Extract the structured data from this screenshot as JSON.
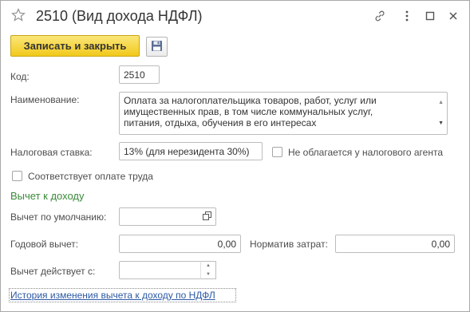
{
  "header": {
    "title": "2510 (Вид дохода НДФЛ)",
    "icons": [
      "star-icon",
      "link-icon",
      "more-icon",
      "maximize-icon",
      "close-icon"
    ]
  },
  "toolbar": {
    "save_close_label": "Записать и закрыть",
    "save_icon": "floppy-disk-icon",
    "accent_color": "#f4d33a"
  },
  "form": {
    "code": {
      "label": "Код:",
      "value": "2510"
    },
    "name": {
      "label": "Наименование:",
      "lines": [
        "Оплата за налогоплательщика товаров, работ, услуг или",
        "имущественных прав, в том числе коммунальных услуг,",
        "питания, отдыха, обучения в его интересах"
      ]
    },
    "rate": {
      "label": "Налоговая ставка:",
      "value": "13% (для нерезидента 30%)"
    },
    "not_taxed": {
      "label": "Не облагается у налогового агента",
      "checked": false
    },
    "labor_payment": {
      "label": "Соответствует оплате труда",
      "checked": false
    }
  },
  "deduction": {
    "section_title": "Вычет к доходу",
    "section_color": "#3a8a3a",
    "default": {
      "label": "Вычет по умолчанию:",
      "value": ""
    },
    "annual": {
      "label": "Годовой вычет:",
      "value": "0,00"
    },
    "cost_norm": {
      "label": "Норматив затрат:",
      "value": "0,00"
    },
    "effective_from": {
      "label": "Вычет действует с:",
      "value": ""
    },
    "history_link": "История изменения вычета к доходу по НДФЛ",
    "link_color": "#2d59a5"
  }
}
